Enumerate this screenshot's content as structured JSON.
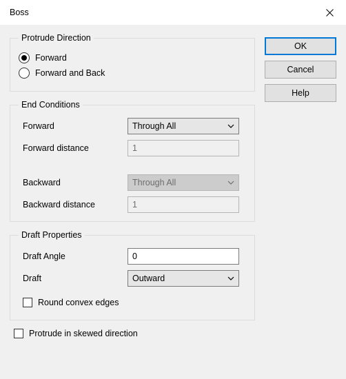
{
  "window": {
    "title": "Boss"
  },
  "buttons": {
    "ok": "OK",
    "cancel": "Cancel",
    "help": "Help"
  },
  "protrude_direction": {
    "legend": "Protrude Direction",
    "forward": "Forward",
    "forward_and_back": "Forward and Back",
    "selected": "forward"
  },
  "end_conditions": {
    "legend": "End Conditions",
    "forward_label": "Forward",
    "forward_value": "Through All",
    "forward_distance_label": "Forward distance",
    "forward_distance_value": "1",
    "backward_label": "Backward",
    "backward_value": "Through All",
    "backward_distance_label": "Backward distance",
    "backward_distance_value": "1"
  },
  "draft_properties": {
    "legend": "Draft Properties",
    "angle_label": "Draft Angle",
    "angle_value": "0",
    "draft_label": "Draft",
    "draft_value": "Outward",
    "round_convex_label": "Round convex edges",
    "round_convex_checked": false
  },
  "protrude_skewed": {
    "label": "Protrude in skewed direction",
    "checked": false
  }
}
